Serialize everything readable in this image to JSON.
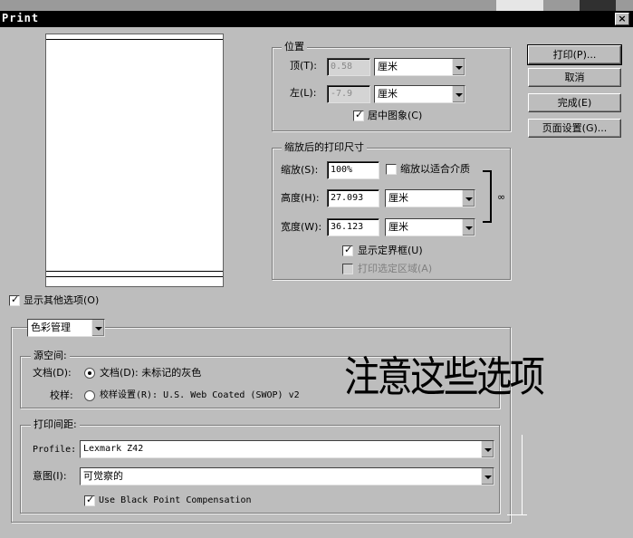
{
  "window": {
    "title": "Print"
  },
  "position": {
    "group_title": "位置",
    "top_label": "顶(T):",
    "top_value": "0.58",
    "top_unit": "厘米",
    "left_label": "左(L):",
    "left_value": "-7.9",
    "left_unit": "厘米",
    "center_image_label": "居中图象(C)",
    "center_image_checked": true
  },
  "scaled_size": {
    "group_title": "缩放后的打印尺寸",
    "scale_label": "缩放(S):",
    "scale_value": "100%",
    "fit_media_label": "缩放以适合介质",
    "fit_media_checked": false,
    "height_label": "高度(H):",
    "height_value": "27.093",
    "height_unit": "厘米",
    "width_label": "宽度(W):",
    "width_value": "36.123",
    "width_unit": "厘米",
    "show_bounding_box_label": "显示定界框(U)",
    "show_bounding_box_checked": true,
    "print_selected_area_label": "打印选定区域(A)",
    "print_selected_area_checked": false
  },
  "buttons": {
    "print": "打印(P)...",
    "cancel": "取消",
    "done": "完成(E)",
    "page_setup": "页面设置(G)..."
  },
  "more_options": {
    "label": "显示其他选项(O)",
    "checked": true
  },
  "color_management": {
    "dropdown_value": "色彩管理",
    "source_space": {
      "group_title": "源空间:",
      "document_label": "文档(D):",
      "document_option": "文档(D): 未标记的灰色",
      "document_selected": true,
      "proof_label": "校样:",
      "proof_option": "校样设置(R): U.S. Web Coated (SWOP) v2",
      "proof_selected": false
    },
    "print_space": {
      "group_title": "打印间距:",
      "profile_label": "Profile:",
      "profile_value": "Lexmark Z42",
      "intent_label": "意图(I):",
      "intent_value": "可觉察的",
      "bpc_label": "Use Black Point Compensation",
      "bpc_checked": true
    }
  },
  "annotation": {
    "text": "注意这些选项"
  }
}
